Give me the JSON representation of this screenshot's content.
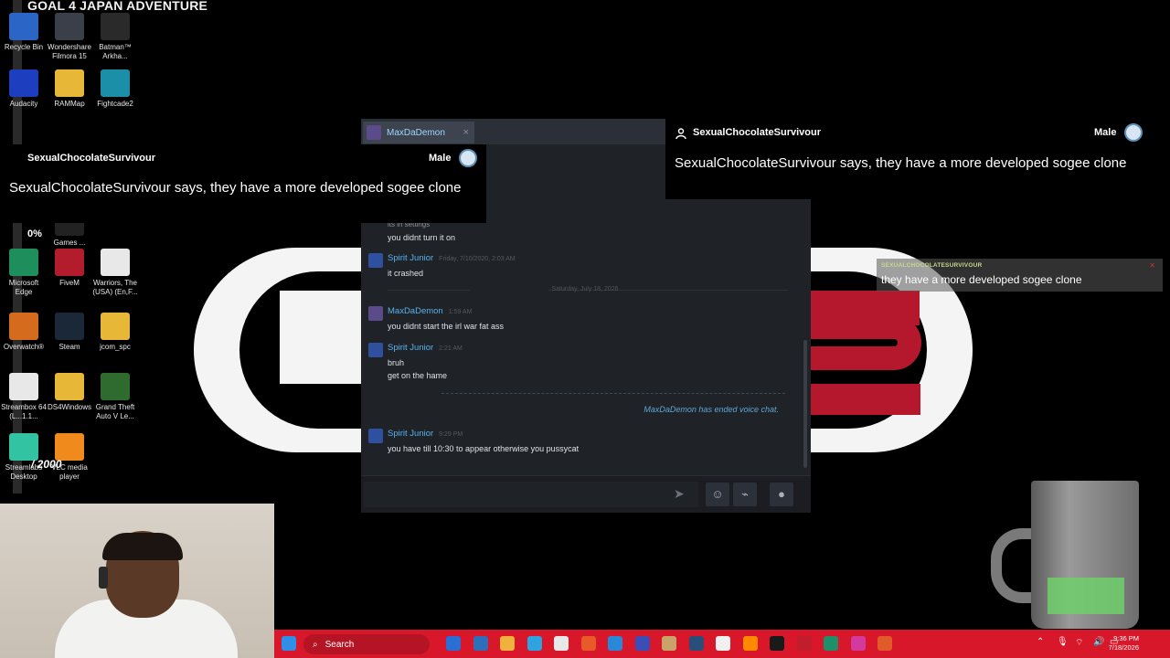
{
  "stream": {
    "title": "GOAL 4 JAPAN ADVENTURE",
    "percent": "0%",
    "counter": "/ 2000"
  },
  "desktop_icons": [
    {
      "label": "Recycle Bin",
      "icon": "recycle-bin-icon",
      "color": "#2b66c7"
    },
    {
      "label": "Wondershare Filmora 15",
      "icon": "filmora-icon",
      "color": "#3a3f4a"
    },
    {
      "label": "Batman™ Arkha...",
      "icon": "batman-icon",
      "color": "#2a2a2a"
    },
    {
      "label": "Audacity",
      "icon": "audacity-icon",
      "color": "#1d3fbf"
    },
    {
      "label": "RAMMap",
      "icon": "folder-icon",
      "color": "#e7b738"
    },
    {
      "label": "Fightcade2",
      "icon": "fightcade-icon",
      "color": "#1c8fa8"
    },
    {
      "label": "Games ...",
      "icon": "games-icon",
      "color": "#222222"
    },
    {
      "label": "Microsoft Edge",
      "icon": "edge-icon",
      "color": "#1e8f5c"
    },
    {
      "label": "FiveM",
      "icon": "fivem-icon",
      "color": "#b31c2c"
    },
    {
      "label": "Warriors, The (USA) (En,F...",
      "icon": "file-icon",
      "color": "#e8e8e8"
    },
    {
      "label": "Overwatch®",
      "icon": "overwatch-icon",
      "color": "#d56b1d"
    },
    {
      "label": "Steam",
      "icon": "steam-icon",
      "color": "#1b2838"
    },
    {
      "label": "jcom_spc",
      "icon": "folder-icon",
      "color": "#e7b738"
    },
    {
      "label": "Streambox 64 (L...1.1...",
      "icon": "file-icon",
      "color": "#e8e8e8"
    },
    {
      "label": "DS4Windows",
      "icon": "folder-icon",
      "color": "#e7b738"
    },
    {
      "label": "Grand Theft Auto V Le...",
      "icon": "gta-icon",
      "color": "#2f6b2f"
    },
    {
      "label": "Streamlabs Desktop",
      "icon": "streamlabs-icon",
      "color": "#31c3a2"
    },
    {
      "label": "VLC media player",
      "icon": "vlc-icon",
      "color": "#f08a1c"
    }
  ],
  "tts_left": {
    "username": "SexualChocolateSurvivour",
    "gender": "Male",
    "message": "SexualChocolateSurvivour says, they have a more developed sogee clone"
  },
  "tts_right": {
    "username": "SexualChocolateSurvivour",
    "gender": "Male",
    "message": "SexualChocolateSurvivour says, they have a more developed sogee clone"
  },
  "chat": {
    "tab_name": "MaxDaDemon",
    "tab_close": "×",
    "messages": [
      {
        "partial_line": "its in settings",
        "line": "you didnt turn it on"
      },
      {
        "name": "Spirit Junior",
        "time": "Friday, 7/10/2020, 2:03 AM",
        "lines": [
          "it crashed"
        ]
      },
      {
        "date_separator": "Saturday, July 18, 2026"
      },
      {
        "name": "MaxDaDemon",
        "time": "1:59 AM",
        "lines": [
          "you didnt start the irl war fat ass"
        ]
      },
      {
        "name": "Spirit Junior",
        "time": "2:21 AM",
        "lines": [
          "bruh",
          "get on the hame"
        ]
      },
      {
        "name": "Spirit Junior",
        "time": "9:29 PM",
        "lines": [
          "you have till 10:30 to appear otherwise you pussycat"
        ]
      }
    ],
    "voice_status": "MaxDaDemon has ended voice chat.",
    "input_value": "",
    "colors": {
      "name": "#56b3ee",
      "text": "#dfe3e8",
      "bg": "#1f2227"
    }
  },
  "overlay_bubble": {
    "username": "SEXUALCHOCOLATESURVIVOUR",
    "message": "they have a more developed sogee clone"
  },
  "taskbar": {
    "search_label": "Search",
    "time": "9:36 PM",
    "date": "7/18/2026",
    "icons": [
      "windows-start-icon",
      "search-icon",
      "task-view-icon",
      "file-explorer-icon",
      "edge-icon",
      "store-icon",
      "app-icon",
      "photos-icon",
      "app-icon",
      "app-icon",
      "steam-icon",
      "media-icon",
      "vlc-icon",
      "obs-icon",
      "app-icon",
      "app-icon",
      "instagram-icon",
      "app-icon",
      "streamlabs-icon"
    ]
  }
}
